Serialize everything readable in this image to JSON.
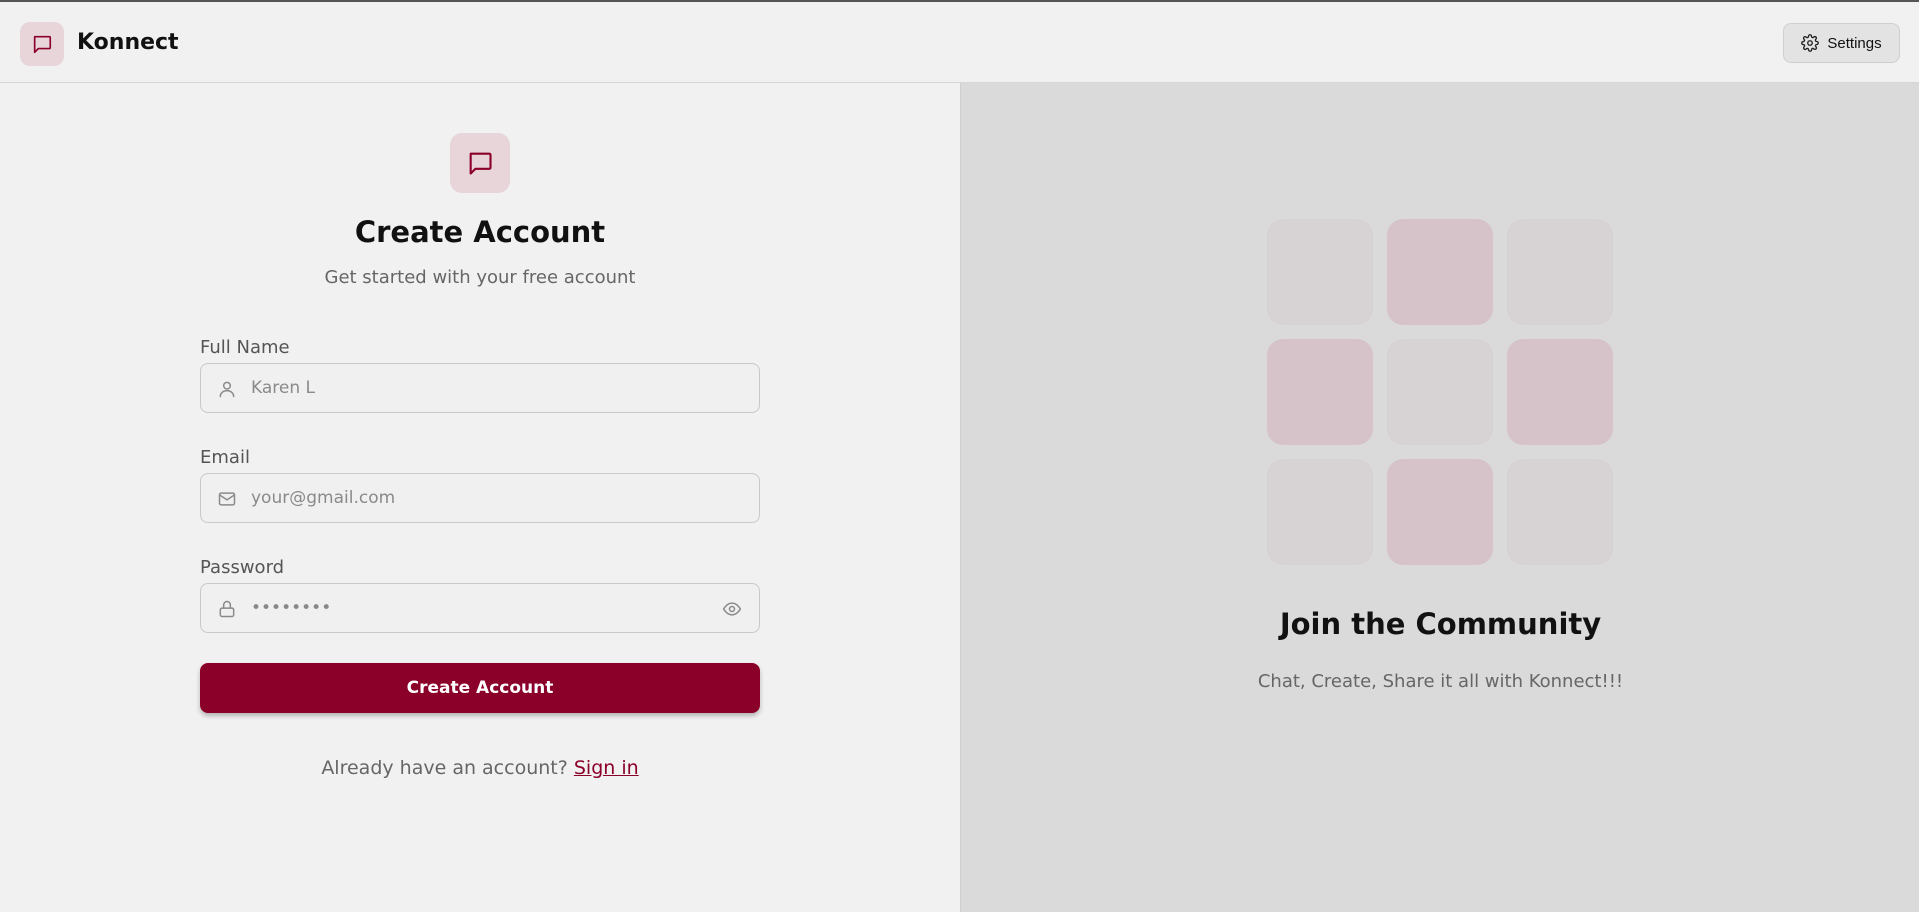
{
  "app": {
    "name": "Konnect"
  },
  "header": {
    "settings_label": "Settings"
  },
  "icons": {
    "brand": "message-square-icon",
    "settings": "gear-icon",
    "name_field": "user-icon",
    "email_field": "mail-icon",
    "password_field": "lock-icon",
    "password_toggle": "eye-icon"
  },
  "form": {
    "title": "Create Account",
    "subtitle": "Get started with your free account",
    "fields": [
      {
        "label": "Full Name",
        "placeholder": "Karen L",
        "value": ""
      },
      {
        "label": "Email",
        "placeholder": "your@gmail.com",
        "value": ""
      },
      {
        "label": "Password",
        "placeholder": "",
        "value": "••••••••"
      }
    ],
    "submit_label": "Create Account",
    "signin_prompt": "Already have an account? ",
    "signin_link": "Sign in"
  },
  "promo": {
    "title": "Join the Community",
    "subtitle": "Chat, Create, Share it all with Konnect!!!",
    "tile_pattern": [
      "light",
      "pink",
      "light",
      "pink",
      "light",
      "pink",
      "light",
      "pink",
      "light"
    ]
  },
  "colors": {
    "accent": "#8b0029",
    "accent_soft": "#e7d5da",
    "page_bg": "#f1f1f1",
    "panel_bg": "#dadada"
  }
}
